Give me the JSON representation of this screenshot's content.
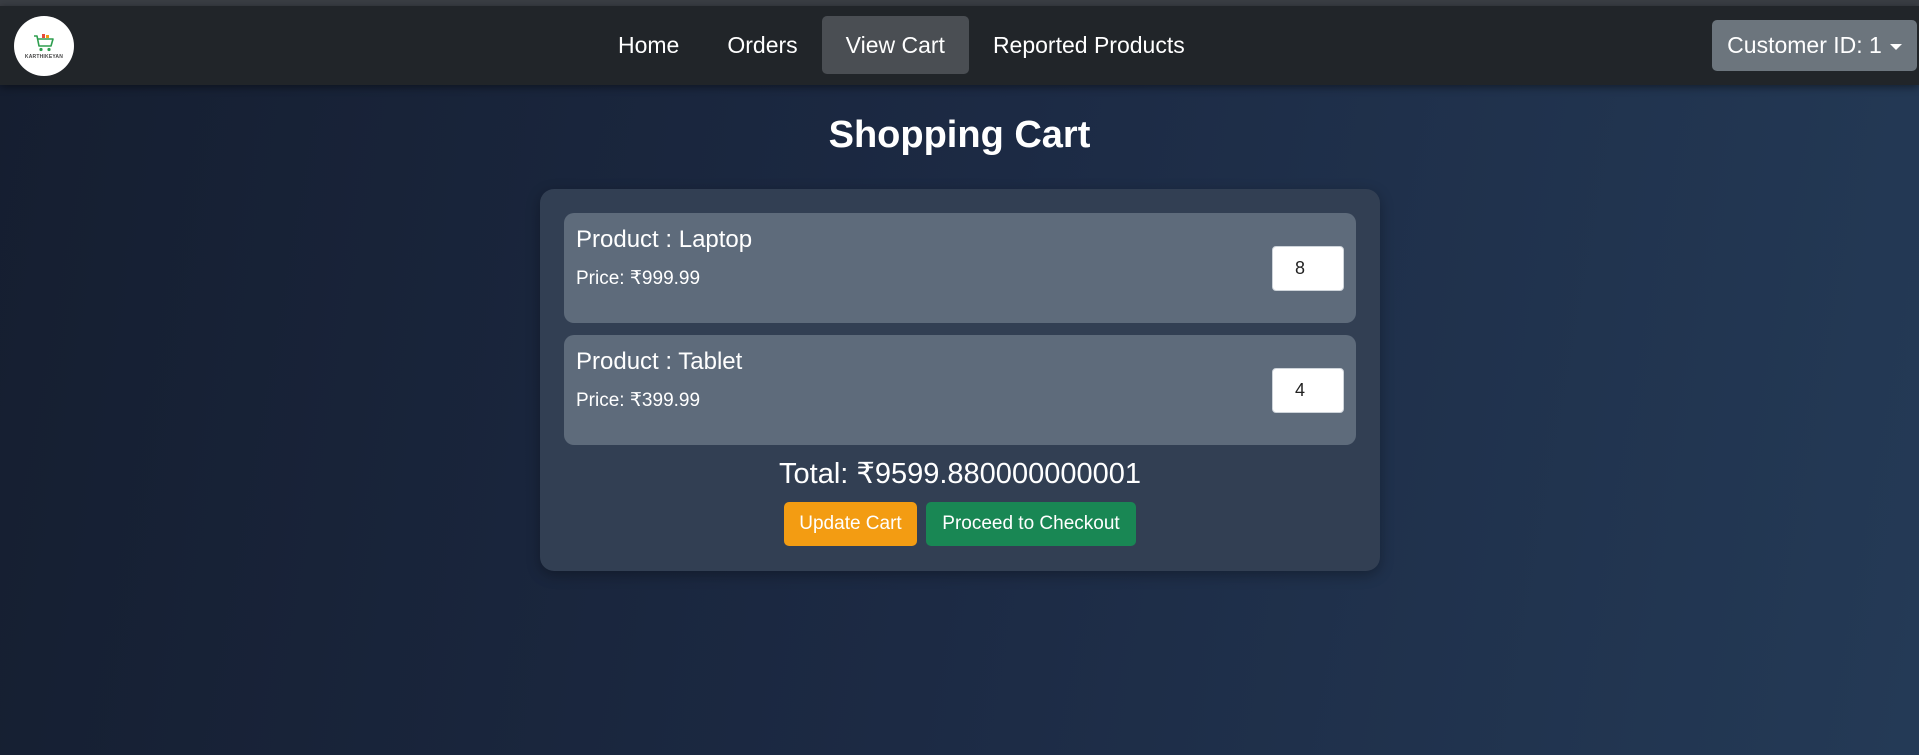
{
  "logo": {
    "text": "KARTHIKEYAN"
  },
  "nav": {
    "items": [
      {
        "label": "Home",
        "active": false
      },
      {
        "label": "Orders",
        "active": false
      },
      {
        "label": "View Cart",
        "active": true
      },
      {
        "label": "Reported Products",
        "active": false
      }
    ]
  },
  "customer": {
    "label": "Customer ID: 1"
  },
  "page": {
    "title": "Shopping Cart"
  },
  "cart": {
    "items": [
      {
        "name": "Product : Laptop",
        "price": "Price: ₹999.99",
        "quantity": "8"
      },
      {
        "name": "Product : Tablet",
        "price": "Price: ₹399.99",
        "quantity": "4"
      }
    ],
    "total": "Total: ₹9599.880000000001",
    "update_label": "Update Cart",
    "checkout_label": "Proceed to Checkout"
  },
  "colors": {
    "navbar": "#212529",
    "active_nav": "#4a4e53",
    "update_button": "#f39c12",
    "checkout_button": "#198754",
    "card": "#323f53",
    "item": "#5e6b7b"
  }
}
